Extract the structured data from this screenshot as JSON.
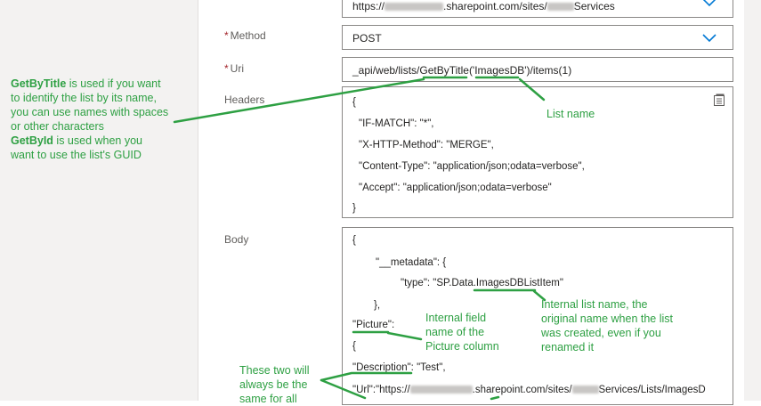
{
  "form": {
    "site_field": {
      "value_prefix": "https://",
      "value_mid": ".sharepoint.com/sites/",
      "value_suffix": "Services"
    },
    "method": {
      "label": "Method",
      "value": "POST"
    },
    "uri": {
      "label": "Uri",
      "value": "_api/web/lists/GetByTitle('ImagesDB')/items(1)"
    },
    "headers": {
      "label": "Headers",
      "lines": [
        "{",
        "\"IF-MATCH\": \"*\",",
        "\"X-HTTP-Method\": \"MERGE\",",
        "\"Content-Type\": \"application/json;odata=verbose\",",
        "\"Accept\": \"application/json;odata=verbose\"",
        "}"
      ]
    },
    "body": {
      "label": "Body",
      "lines": [
        "{",
        "\"__metadata\": {",
        "\"type\": \"SP.Data.ImagesDBListItem\"",
        "},",
        "\"Picture\":",
        "{",
        "\"Description\": \"Test\",",
        "\"Url\":\"https://",
        ".sharepoint.com/sites/",
        "Services/Lists/ImagesD"
      ]
    },
    "required_mark": "*"
  },
  "annotations": {
    "getbytitle": {
      "title": "GetByTitle",
      "text1": " is used if you want",
      "text2": "to identify the list by its name,",
      "text3": "you can use names with spaces",
      "text4": "or other characters"
    },
    "getbyid": {
      "title": "GetById",
      "text1": " is used when you",
      "text2": "want to use the list's GUID"
    },
    "list_name": "List name",
    "internal_list_name": [
      "Internal list name, the",
      "original name when the list",
      "was created, even if you",
      "renamed it"
    ],
    "internal_field": [
      "Internal field",
      "name of the",
      "Picture column"
    ],
    "always_same": [
      "These two will",
      "always be the",
      "same for all"
    ]
  },
  "colors": {
    "accent": "#0078d4",
    "annotation": "#2ea043",
    "required": "#a4262c"
  },
  "icons": {
    "dropdown": "chevron-down-icon",
    "expand": "expand-editor-icon"
  }
}
